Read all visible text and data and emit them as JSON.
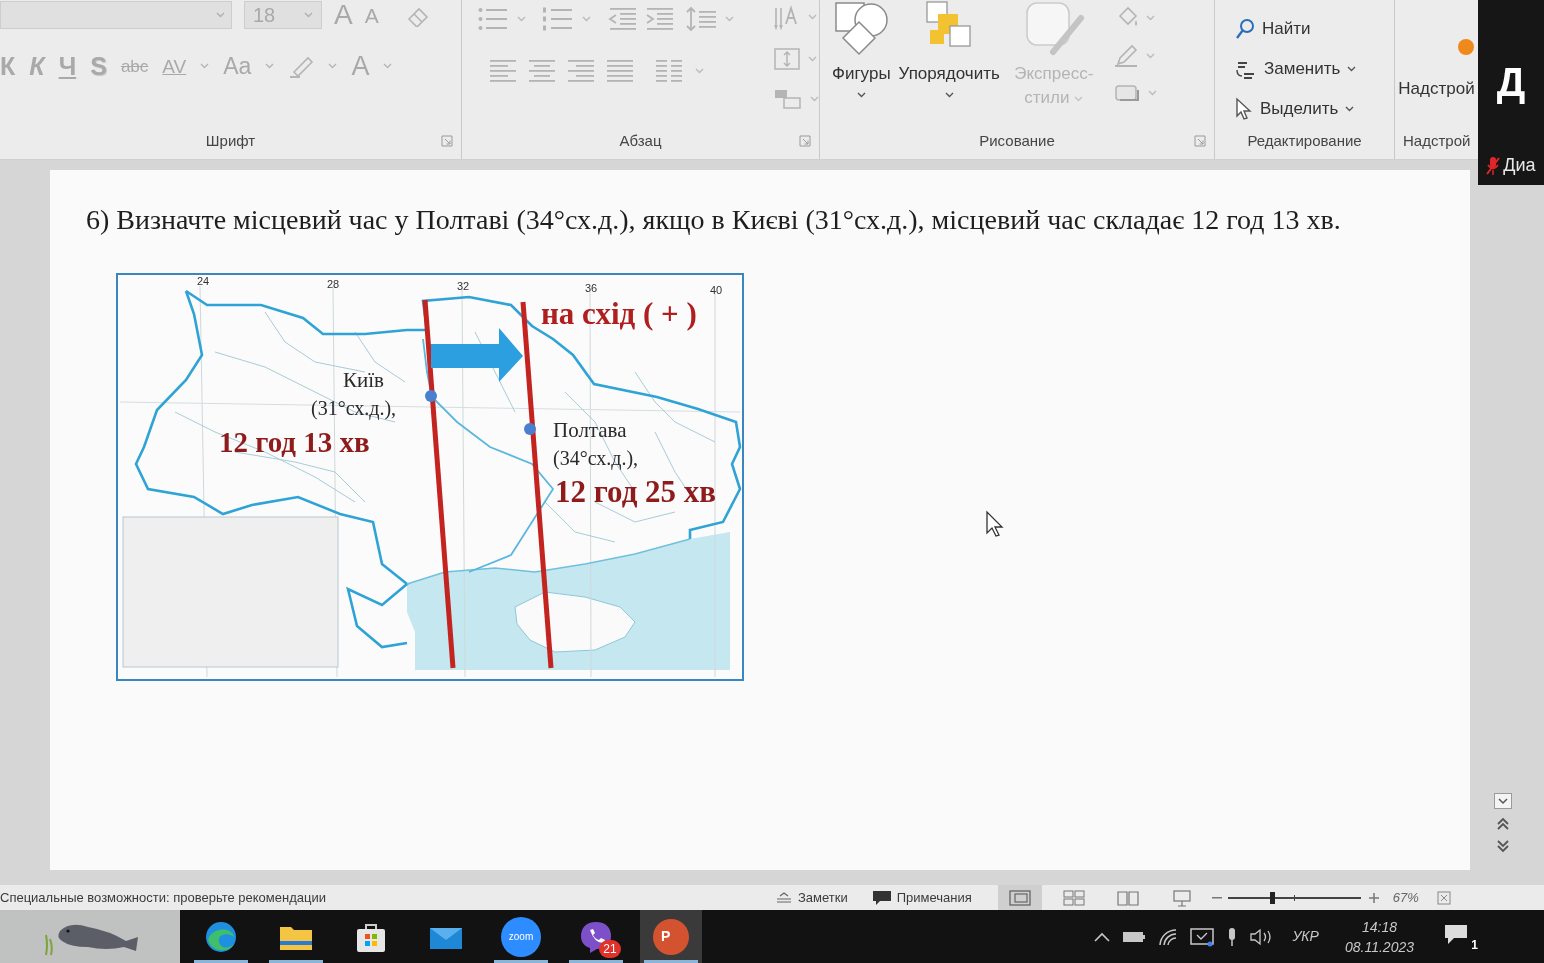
{
  "ribbon": {
    "font": {
      "label": "Шрифт",
      "size": {
        "value": "18",
        "disabled": true
      },
      "top": [
        {
          "kind": "grow",
          "text": "A",
          "disabled": true
        },
        {
          "kind": "shrink",
          "text": "A",
          "disabled": true
        }
      ],
      "bottom": [
        {
          "kind": "bold",
          "text": "К",
          "disabled": true
        },
        {
          "kind": "italic",
          "text": "К",
          "disabled": true
        },
        {
          "kind": "underline",
          "text": "Ч",
          "disabled": true
        },
        {
          "kind": "shadow",
          "text": "S",
          "disabled": true
        },
        {
          "kind": "strike",
          "text": "abc",
          "disabled": true
        },
        {
          "kind": "spacing",
          "text": "AV",
          "disabled": true
        },
        {
          "kind": "case",
          "text": "Aa",
          "disabled": true
        },
        {
          "kind": "color",
          "text": "A",
          "disabled": true
        }
      ]
    },
    "paragraph": {
      "label": "Абзац"
    },
    "drawing": {
      "label": "Рисование",
      "buttons": [
        {
          "kind": "shapes",
          "label": "Фигуры",
          "disabled": false
        },
        {
          "kind": "arrange",
          "label": "Упорядочить",
          "disabled": false
        },
        {
          "kind": "styles",
          "label": "Экспресс-стили",
          "disabled": true
        }
      ]
    },
    "editing": {
      "label": "Редактирование",
      "buttons": [
        {
          "kind": "find",
          "label": "Найти"
        },
        {
          "kind": "replace",
          "label": "Заменить"
        },
        {
          "kind": "select",
          "label": "Выделить"
        }
      ]
    },
    "addins": {
      "button": "Надстрой",
      "label": "Надстрой"
    }
  },
  "video_tile": {
    "initial": "Д",
    "name": "Диа",
    "muted": true
  },
  "slide": {
    "question": "6) Визначте місцевий час у Полтаві (34°сх.д.), якщо в Києві (31°сх.д.), місцевий час складає 12 год 13 хв.",
    "map": {
      "longitudes": [
        "24",
        "28",
        "32",
        "36",
        "40"
      ],
      "direction": "на схід ( + )",
      "cities": [
        {
          "name": "Київ",
          "coordinates": "(31°сх.д.),",
          "time": "12 год 13 хв"
        },
        {
          "name": "Полтава",
          "coordinates": "(34°сх.д.),",
          "time": "12 год 25 хв"
        }
      ]
    }
  },
  "status_bar": {
    "accessibility": "Специальные возможности: проверьте рекомендации",
    "notes": "Заметки",
    "comments": "Примечания",
    "views": [
      {
        "kind": "normal",
        "selected": true
      },
      {
        "kind": "sorter",
        "selected": false
      },
      {
        "kind": "reading",
        "selected": false
      },
      {
        "kind": "slideshow",
        "selected": false
      }
    ],
    "zoom": {
      "level": 0.33,
      "value": "67%"
    }
  },
  "taskbar": {
    "apps": [
      {
        "kind": "browser",
        "running": true,
        "selected": false
      },
      {
        "kind": "folder",
        "running": true,
        "selected": false
      },
      {
        "kind": "store",
        "running": false,
        "selected": false
      },
      {
        "kind": "mail",
        "running": false,
        "selected": false
      },
      {
        "kind": "video",
        "label": "zoom",
        "running": true,
        "selected": false
      },
      {
        "kind": "messenger",
        "badge": "21",
        "running": true,
        "selected": false
      },
      {
        "kind": "slides",
        "label": "P",
        "running": true,
        "selected": true
      }
    ],
    "tray": {
      "language": "УКР",
      "time": "14:18",
      "date": "08.11.2023",
      "notifications": "1"
    }
  }
}
